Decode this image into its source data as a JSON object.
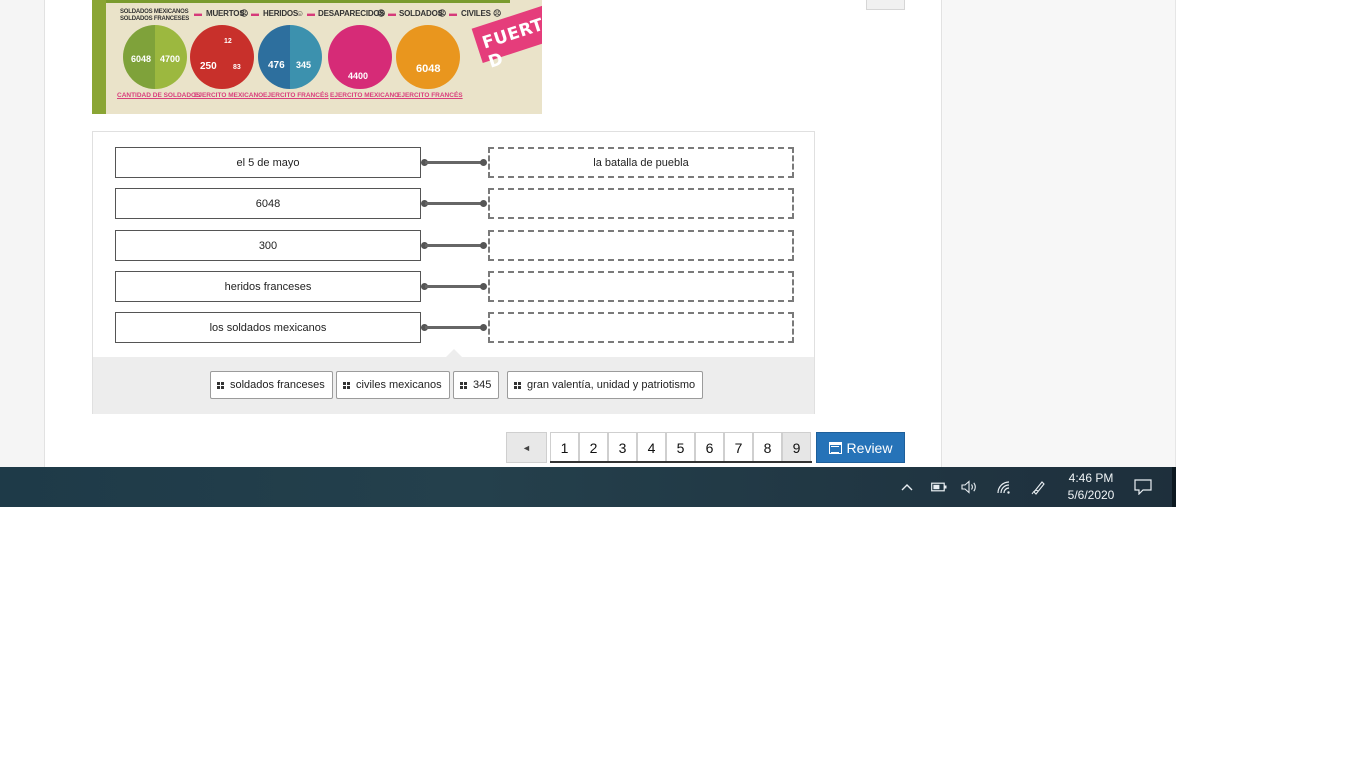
{
  "infographic": {
    "legend_left_line1": "SOLDADOS MEXICANOS",
    "legend_left_line2": "SOLDADOS FRANCESES",
    "legend_items": [
      "MUERTOS",
      "HERIDOS",
      "DESAPARECIDOS",
      "SOLDADOS",
      "CIVILES"
    ],
    "circles": [
      {
        "values": [
          "6048",
          "4700"
        ],
        "caption": "CANTIDAD DE SOLDADOS"
      },
      {
        "values": [
          "250",
          "12",
          "83"
        ],
        "caption": "EJERCITO MEXICANO"
      },
      {
        "values": [
          "476",
          "345"
        ],
        "caption": "EJERCITO FRANCÉS"
      },
      {
        "values": [
          "4400"
        ],
        "caption": "EJERCITO MEXICANO"
      },
      {
        "values": [
          "6048"
        ],
        "caption": "EJERCITO FRANCÉS"
      }
    ],
    "banner": "FUERTE D",
    "colors": {
      "green": "#8aa534",
      "red": "#c9312b",
      "blue": "#2f7aa6",
      "pink": "#d62b77",
      "orange": "#e9961e"
    }
  },
  "match": {
    "rows": [
      {
        "prompt": "el 5 de mayo",
        "answer": "la batalla de puebla"
      },
      {
        "prompt": "6048",
        "answer": ""
      },
      {
        "prompt": "300",
        "answer": ""
      },
      {
        "prompt": "heridos franceses",
        "answer": ""
      },
      {
        "prompt": "los soldados mexicanos",
        "answer": ""
      }
    ],
    "bank": [
      "soldados franceses",
      "civiles mexicanos",
      "345",
      "gran valentía, unidad y patriotismo"
    ]
  },
  "pager": {
    "prev_symbol": "◄",
    "pages": [
      "1",
      "2",
      "3",
      "4",
      "5",
      "6",
      "7",
      "8",
      "9"
    ],
    "current": "9",
    "review_label": "Review"
  },
  "taskbar": {
    "time": "4:46 PM",
    "date": "5/6/2020",
    "icons": [
      "chevron-up-icon",
      "battery-icon",
      "volume-icon",
      "wifi-icon",
      "pen-icon",
      "notification-icon"
    ]
  }
}
